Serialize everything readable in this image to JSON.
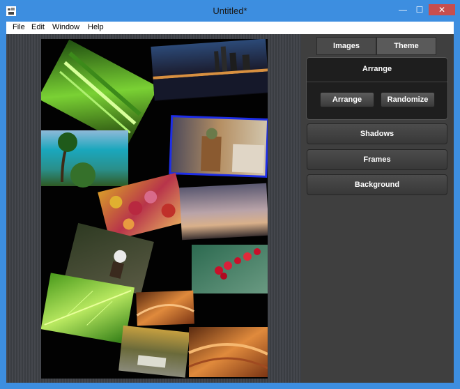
{
  "window": {
    "title": "Untitled*",
    "min_glyph": "—",
    "max_glyph": "☐",
    "close_glyph": "✕"
  },
  "menu": {
    "items": [
      "File",
      "Edit",
      "Window",
      "Help"
    ]
  },
  "panel": {
    "tabs": [
      {
        "label": "Images"
      },
      {
        "label": "Theme"
      }
    ],
    "arrange_section": {
      "title": "Arrange",
      "arrange_button": "Arrange",
      "randomize_button": "Randomize"
    },
    "shadows_button": "Shadows",
    "frames_button": "Frames",
    "background_button": "Background"
  },
  "colors": {
    "titlebar": "#3d8ee0",
    "close": "#c74e4e",
    "selected_frame": "#1e2ee6",
    "panel_bg": "#3f3f3f",
    "canvas_bg": "#020202"
  }
}
